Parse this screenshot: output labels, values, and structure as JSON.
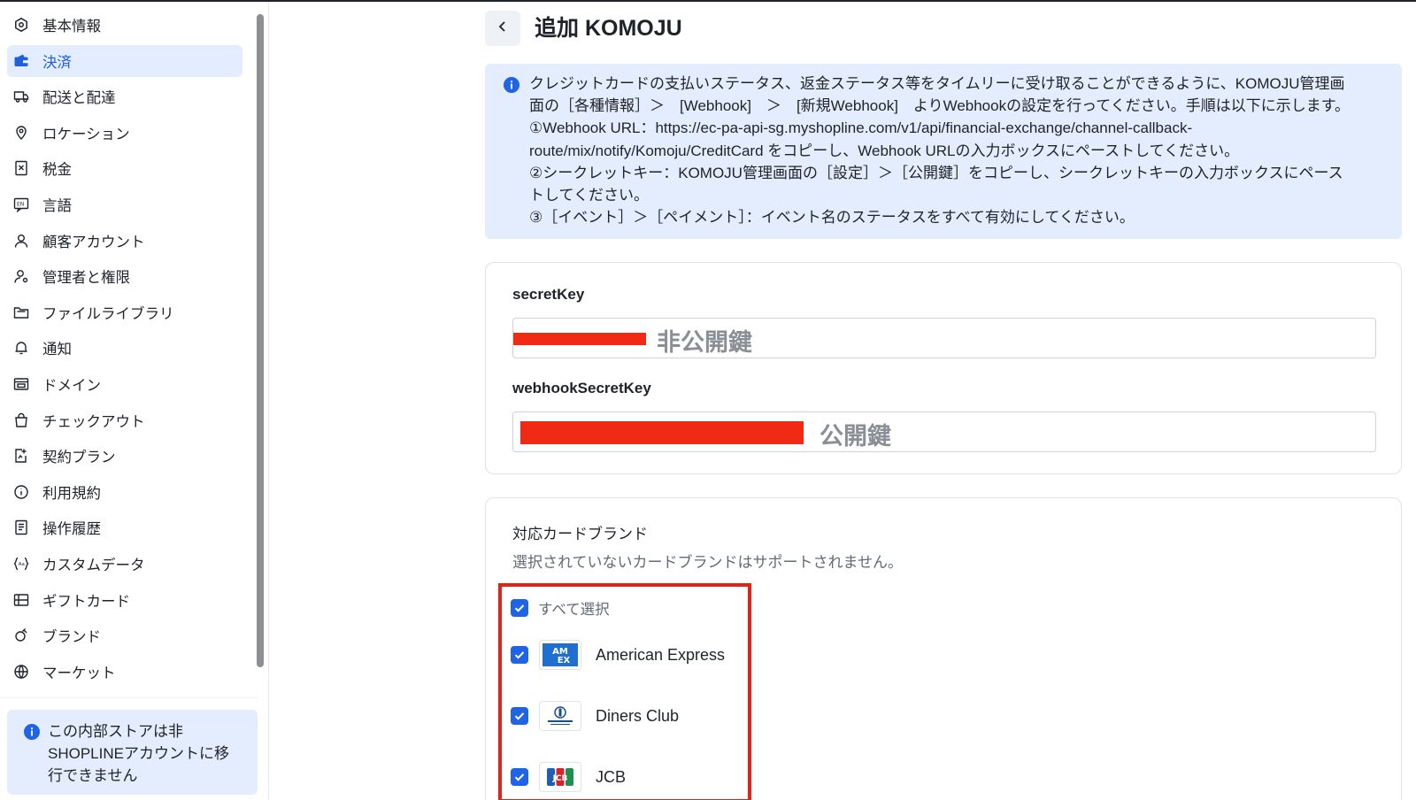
{
  "sidebar": {
    "items": [
      {
        "label": "基本情報",
        "icon": "hexagon-icon",
        "active": false
      },
      {
        "label": "決済",
        "icon": "wallet-icon",
        "active": true
      },
      {
        "label": "配送と配達",
        "icon": "truck-icon",
        "active": false
      },
      {
        "label": "ロケーション",
        "icon": "location-pin-icon",
        "active": false
      },
      {
        "label": "税金",
        "icon": "tax-document-icon",
        "active": false
      },
      {
        "label": "言語",
        "icon": "language-icon",
        "active": false
      },
      {
        "label": "顧客アカウント",
        "icon": "user-icon",
        "active": false
      },
      {
        "label": "管理者と権限",
        "icon": "user-permission-icon",
        "active": false
      },
      {
        "label": "ファイルライブラリ",
        "icon": "folder-icon",
        "active": false
      },
      {
        "label": "通知",
        "icon": "bell-icon",
        "active": false
      },
      {
        "label": "ドメイン",
        "icon": "domain-icon",
        "active": false
      },
      {
        "label": "チェックアウト",
        "icon": "shopping-bag-icon",
        "active": false
      },
      {
        "label": "契約プラン",
        "icon": "plan-icon",
        "active": false
      },
      {
        "label": "利用規約",
        "icon": "info-circle-icon",
        "active": false
      },
      {
        "label": "操作履歴",
        "icon": "history-icon",
        "active": false
      },
      {
        "label": "カスタムデータ",
        "icon": "custom-data-icon",
        "active": false
      },
      {
        "label": "ギフトカード",
        "icon": "gift-card-icon",
        "active": false
      },
      {
        "label": "ブランド",
        "icon": "brand-icon",
        "active": false
      },
      {
        "label": "マーケット",
        "icon": "globe-icon",
        "active": false
      }
    ],
    "notice": {
      "lines": [
        "この内部ストアは非",
        "SHOPLINEアカウントに移",
        "行できません"
      ]
    }
  },
  "header": {
    "title": "追加 KOMOJU"
  },
  "notice": {
    "lines": [
      "クレジットカードの支払いステータス、返金ステータス等をタイムリーに受け取ることができるように、KOMOJU管理画",
      "面の［各種情報］＞　[Webhook]　＞　[新規Webhook]　よりWebhookの設定を行ってください。手順は以下に示します。",
      "①Webhook URL：https://ec-pa-api-sg.myshopline.com/v1/api/financial-exchange/channel-callback-",
      "route/mix/notify/Komoju/CreditCard をコピーし、Webhook URLの入力ボックスにペーストしてください。",
      "②シークレットキー：KOMOJU管理画面の［設定］＞［公開鍵］をコピーし、シークレットキーの入力ボックスにペース",
      "トしてください。",
      "③［イベント］＞［ペイメント］：イベント名のステータスをすべて有効にしてください。"
    ]
  },
  "keys": {
    "secret_label": "secretKey",
    "secret_value": "非公開鍵",
    "webhook_label": "webhookSecretKey",
    "webhook_value": "公開鍵"
  },
  "brands": {
    "title": "対応カードブランド",
    "subtitle": "選択されていないカードブランドはサポートされません。",
    "select_all": "すべて選択",
    "items": [
      {
        "label": "American Express",
        "checked": true,
        "icon": "amex-logo-icon"
      },
      {
        "label": "Diners Club",
        "checked": true,
        "icon": "diners-club-logo-icon"
      },
      {
        "label": "JCB",
        "checked": true,
        "icon": "jcb-logo-icon"
      }
    ]
  },
  "colors": {
    "accent": "#1f63e6",
    "active_bg": "#e4edfd",
    "highlight_border": "#e8201a",
    "redaction": "#f02a14"
  }
}
